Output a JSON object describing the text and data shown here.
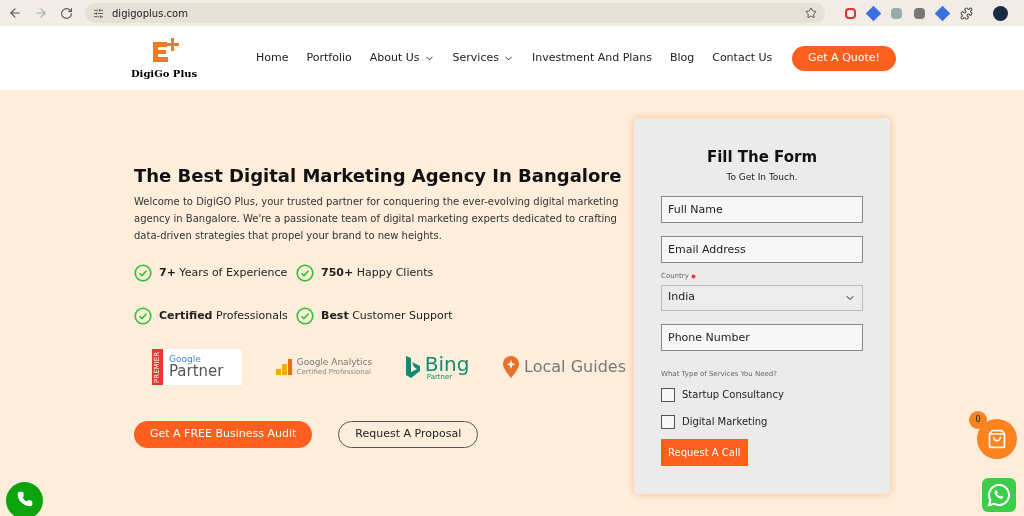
{
  "browser": {
    "url": "digigoplus.com"
  },
  "header": {
    "logo": "DigiGo Plus",
    "nav": [
      {
        "label": "Home",
        "dropdown": false
      },
      {
        "label": "Portfolio",
        "dropdown": false
      },
      {
        "label": "About Us",
        "dropdown": true
      },
      {
        "label": "Services",
        "dropdown": true
      },
      {
        "label": "Investment And Plans",
        "dropdown": false
      },
      {
        "label": "Blog",
        "dropdown": false
      },
      {
        "label": "Contact Us",
        "dropdown": false
      }
    ],
    "cta": "Get A Quote!"
  },
  "hero": {
    "title": "The Best Digital Marketing Agency In Bangalore",
    "text": "Welcome to DigiGO Plus, your trusted partner for conquering the ever-evolving digital marketing agency in Bangalore. We're a passionate team of digital marketing experts dedicated to crafting data-driven strategies that propel your brand to new heights.",
    "features": [
      "**7+** Years of Experience",
      "**750+** Happy Clients",
      "**Certified** Professionals",
      "**Best** Customer Support"
    ],
    "badges": [
      {
        "kind": "google-partner",
        "tag": "PREMIER",
        "name": "Google",
        "sub": "Partner"
      },
      {
        "kind": "analytics",
        "name": "Google Analytics",
        "sub": "Certified Professional"
      },
      {
        "kind": "bing",
        "name": "Bing",
        "sub": "Partner"
      },
      {
        "kind": "local-guides",
        "name": "Local Guides"
      }
    ],
    "buttons": [
      {
        "label": "Get A FREE Business Audit",
        "kind": "primary"
      },
      {
        "label": "Request A Proposal",
        "kind": "outline"
      }
    ]
  },
  "form": {
    "title": "Fill The Form",
    "subtitle": "To Get In Touch.",
    "fields": [
      {
        "kind": "input",
        "placeholder": "Full Name"
      },
      {
        "kind": "input",
        "placeholder": "Email Address"
      },
      {
        "kind": "select",
        "label": "Country",
        "required": true,
        "value": "India"
      },
      {
        "kind": "input",
        "placeholder": "Phone Number"
      }
    ],
    "services_label": "What Type of Services You Need?",
    "services": [
      {
        "label": "Startup Consultancy",
        "checked": false
      },
      {
        "label": "Digital Marketing",
        "checked": false
      }
    ],
    "submit": "Request A Call"
  },
  "cart": {
    "count": "0"
  }
}
